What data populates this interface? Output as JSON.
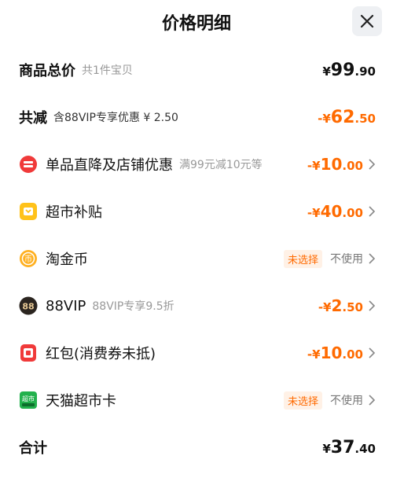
{
  "header": {
    "title": "价格明细"
  },
  "total_goods": {
    "label": "商品总价",
    "sub": "共1件宝贝",
    "symbol": "¥",
    "int": "99",
    "dec": ".90"
  },
  "reduction": {
    "label": "共减",
    "sub": "含88VIP专享优惠 ¥ 2.50",
    "symbol": "-¥",
    "int": "62",
    "dec": ".50"
  },
  "items": [
    {
      "label": "单品直降及店铺优惠",
      "sub": "满99元减10元等",
      "symbol": "-¥",
      "int": "10",
      "dec": ".00",
      "icon": "store-discount-icon"
    },
    {
      "label": "超市补贴",
      "sub": "",
      "symbol": "-¥",
      "int": "40",
      "dec": ".00",
      "icon": "supermarket-subsidy-icon"
    },
    {
      "label": "淘金币",
      "badge": "未选择",
      "status": "不使用",
      "icon": "taojinbi-coin-icon"
    },
    {
      "label": "88VIP",
      "sub": "88VIP专享9.5折",
      "symbol": "-¥",
      "int": "2",
      "dec": ".50",
      "icon": "88vip-icon",
      "icon_text": "88"
    },
    {
      "label": "红包(消费券未抵)",
      "sub": "",
      "symbol": "-¥",
      "int": "10",
      "dec": ".00",
      "icon": "red-packet-icon"
    },
    {
      "label": "天猫超市卡",
      "badge": "未选择",
      "status": "不使用",
      "icon": "tmall-card-icon",
      "icon_text": "超市"
    }
  ],
  "total": {
    "label": "合计",
    "symbol": "¥",
    "int": "37",
    "dec": ".40"
  },
  "colors": {
    "accent": "#ff6a00",
    "badge_bg": "#fff1e6",
    "muted": "#999999"
  }
}
